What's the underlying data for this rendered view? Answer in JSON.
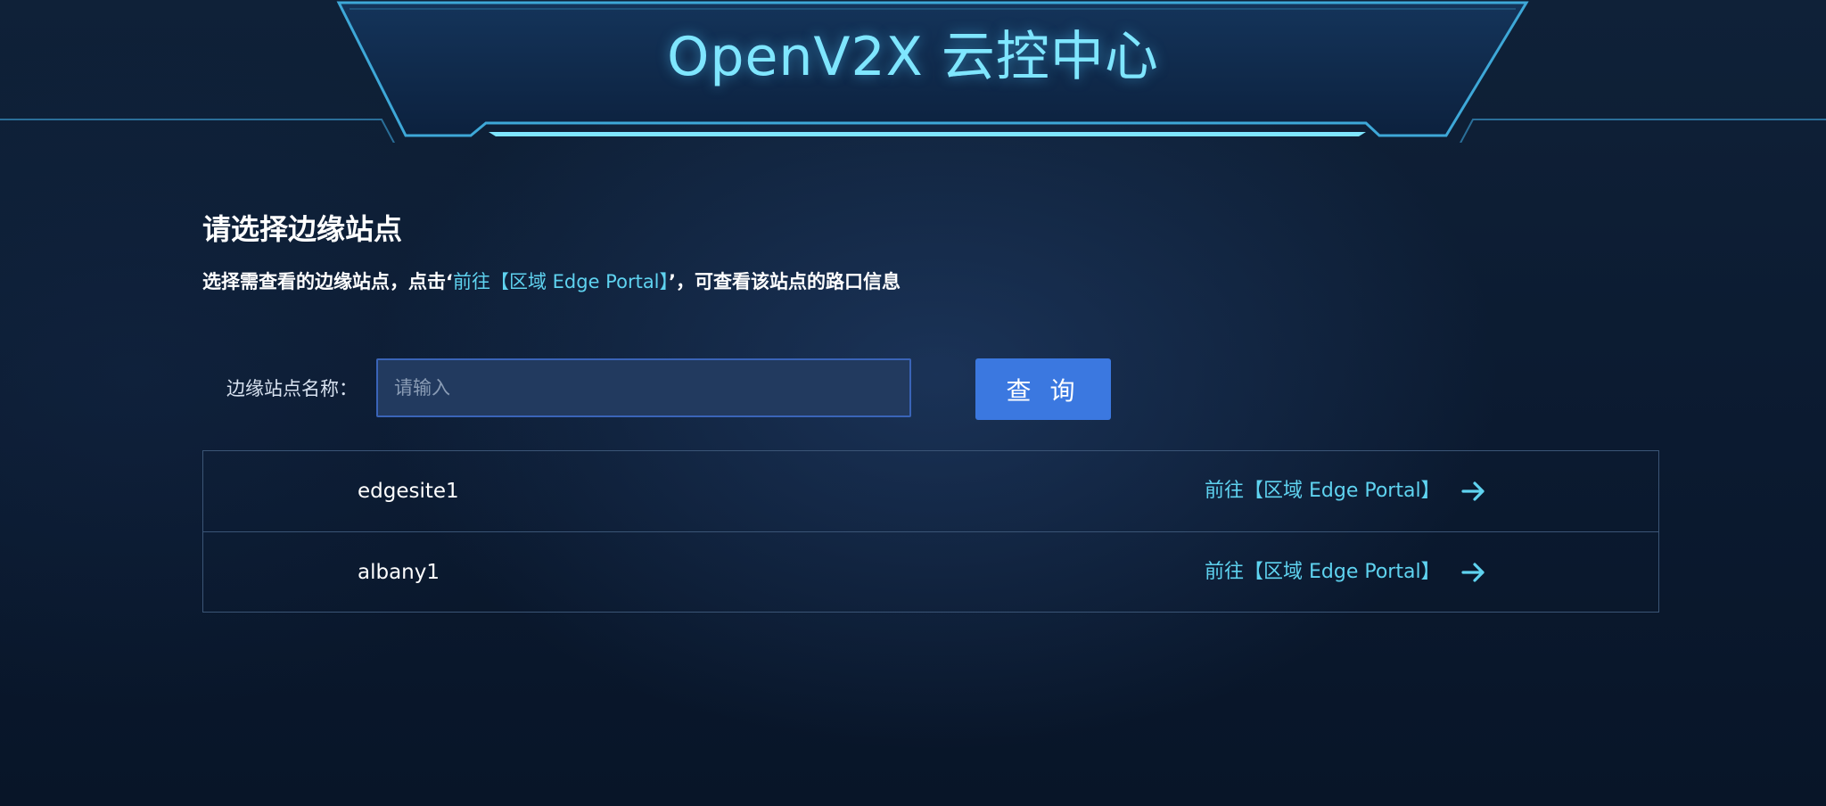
{
  "header": {
    "title": "OpenV2X 云控中心"
  },
  "section": {
    "title": "请选择边缘站点",
    "desc_prefix": "选择需查看的边缘站点，点击‘",
    "desc_link": "前往【区域 Edge Portal】",
    "desc_suffix": "’，可查看该站点的路口信息"
  },
  "search": {
    "label": "边缘站点名称：",
    "value": "",
    "placeholder": "请输入",
    "button_label": "查 询"
  },
  "sites": [
    {
      "name": "edgesite1",
      "link_label": "前往【区域 Edge Portal】",
      "icon": "arrow-right-icon"
    },
    {
      "name": "albany1",
      "link_label": "前往【区域 Edge Portal】",
      "icon": "arrow-right-icon"
    }
  ],
  "colors": {
    "accent": "#7fe6ff",
    "link": "#5fd3f0",
    "button": "#3b78e0",
    "background": "#0b1a30"
  }
}
